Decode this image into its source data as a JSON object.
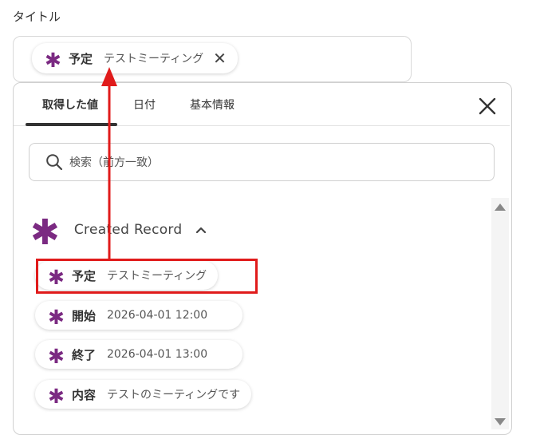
{
  "field": {
    "label": "タイトル",
    "chip": {
      "key": "予定",
      "value": "テストミーティング",
      "remove": "✕"
    }
  },
  "tabs": [
    {
      "label": "取得した値",
      "active": true
    },
    {
      "label": "日付",
      "active": false
    },
    {
      "label": "基本情報",
      "active": false
    }
  ],
  "search": {
    "placeholder": "検索（前方一致）"
  },
  "group": {
    "name": "Created Record",
    "expanded": true
  },
  "items": [
    {
      "key": "予定",
      "value": "テストミーティング",
      "highlighted": true
    },
    {
      "key": "開始",
      "value": "2026-04-01 12:00"
    },
    {
      "key": "終了",
      "value": "2026-04-01 13:00"
    },
    {
      "key": "内容",
      "value": "テストのミーティングです"
    }
  ],
  "colors": {
    "accent": "#7b2a82",
    "highlight": "#e01b1b"
  },
  "icons": {
    "chip": "asterisk-icon",
    "close": "close-icon",
    "search": "search-icon",
    "collapse": "chevron-up-icon"
  }
}
